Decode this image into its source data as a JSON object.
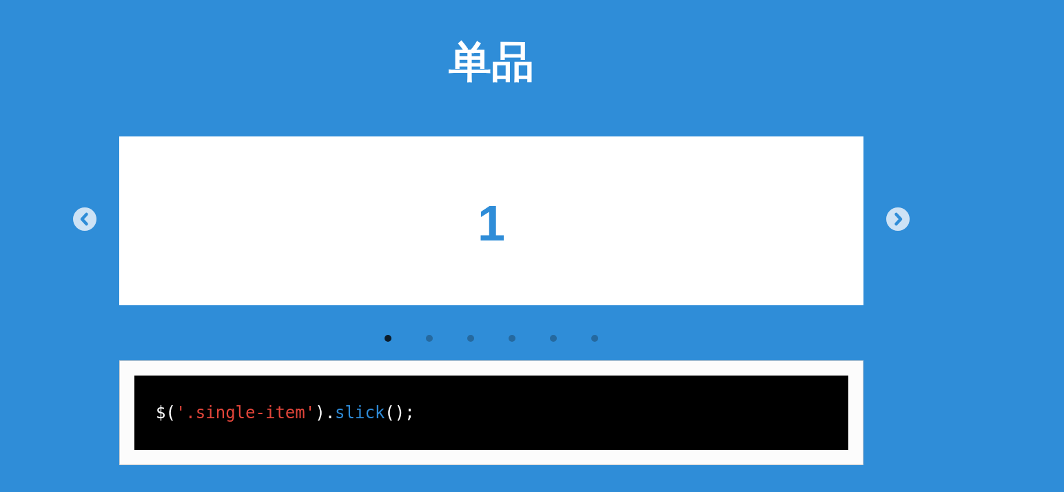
{
  "title": "单品",
  "carousel": {
    "slides": [
      {
        "label": "1"
      }
    ],
    "dots": [
      {
        "selected": true
      },
      {
        "selected": false
      },
      {
        "selected": false
      },
      {
        "selected": false
      },
      {
        "selected": false
      },
      {
        "selected": false
      }
    ]
  },
  "code": {
    "tokens": [
      {
        "kind": "plain",
        "text": "$("
      },
      {
        "kind": "string",
        "text": "'.single-item'"
      },
      {
        "kind": "plain",
        "text": ")."
      },
      {
        "kind": "function",
        "text": "slick"
      },
      {
        "kind": "plain",
        "text": "();"
      }
    ]
  }
}
